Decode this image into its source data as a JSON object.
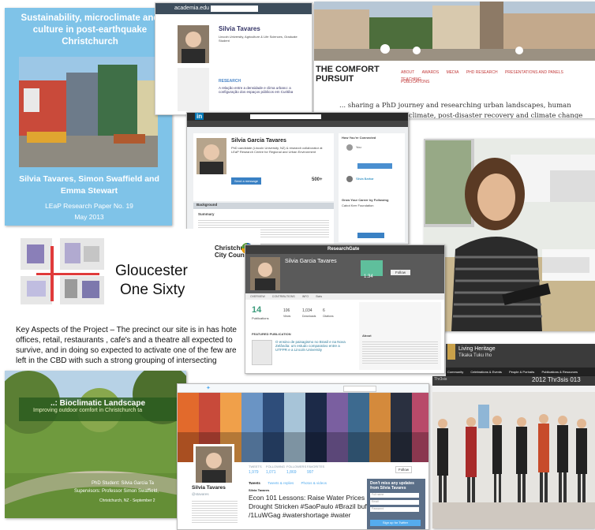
{
  "paper": {
    "title": "Sustainability, microclimate and culture in post-earthquake Christchurch",
    "authors": "Silvia Tavares, Simon Swaffield and Emma Stewart",
    "series": "LEaP Research Paper No. 19",
    "date": "May 2013"
  },
  "academia": {
    "logo": "academia.edu",
    "name": "Silvia Tavares",
    "subtitle": "Lincoln University, Agriculture & Life Sciences, Graduate Student",
    "section": "RESEARCH",
    "paper_title": "A relação entre a densidade e clima urbano: a configuração dos espaços públicos em Curitiba"
  },
  "blog": {
    "title_line1": "THE COMFORT",
    "title_line2": "PURSUIT",
    "nav": [
      "ABOUT",
      "AWARDS",
      "MEDIA",
      "PHD RESEARCH",
      "PRESENTATIONS AND PANELS",
      "PUBLICATIONS",
      "TEACHING"
    ],
    "tagline1": "... sharing a PhD journey and researching urban landscapes, human",
    "tagline2": "climate, post-disaster recovery and climate change"
  },
  "linkedin": {
    "logo": "in",
    "name": "Silvia Garcia Tavares",
    "headline": "PhD candidate (Lincoln University, NZ) & research collaborator at LEaP Research Centre for Regional and Urban Environment",
    "section": "Background",
    "summary_title": "Summary",
    "side_title": "How You're Connected",
    "side_you": "You",
    "side_person": "Silvia Barbar",
    "side_cta": "Grow Your Career by Following",
    "side_company": "Cabot Kerr Foundation",
    "connections": "500+",
    "send_button": "Send a message"
  },
  "gloucester": {
    "title_line1": "Gloucester",
    "title_line2": "One Sixty",
    "council": "Christchurch",
    "council2": "City Council",
    "body1": "Key Aspects of the Project – The precinct our site is in has hote",
    "body2": "offices, retail, restaurants , cafe's and a theatre all expected to",
    "body3": "survive, and in doing so  expected to activate one of the few are",
    "body4": "left in the CBD with such a strong grouping of intersecting"
  },
  "researchgate": {
    "logo": "ResearchGate",
    "name": "Silvia Garcia Tavares",
    "score": "1.34",
    "stat_main": "14",
    "stat_main_label": "Publications",
    "stats": [
      "106",
      "1,034",
      "6"
    ],
    "stat_labels": [
      "Views",
      "Downloads",
      "Citations"
    ],
    "tabs": [
      "OVERVIEW",
      "CONTRIBUTIONS",
      "INFO",
      "Stats"
    ],
    "section": "FEATURED PUBLICATION",
    "pub": "O ensino de paisagismo no Brasil e na Nova Zelândia: um estudo comparativo entre a UTFPR e a Lincoln University",
    "about": "About",
    "follow": "Follow"
  },
  "bioclimatic": {
    "title": "..: Bioclimatic Landscape",
    "subtitle": "Improving outdoor comfort in Christchurch ta",
    "phd": "PhD Student: Silvia Garcia Ta",
    "supervisors": "Supervisors: Professor Simon Swaffield,",
    "place": "Christchurch, NZ - September 2"
  },
  "twitter": {
    "name": "Silvia Tavares",
    "handle": "@stavares",
    "stats": [
      "1,979",
      "1,071",
      "1,869",
      "997"
    ],
    "stat_labels": [
      "TWEETS",
      "FOLLOWING",
      "FOLLOWERS",
      "FAVORITES"
    ],
    "tabs": [
      "Tweets",
      "Tweets & replies",
      "Photos & videos"
    ],
    "tweet_author": "Silvia Tavares",
    "tweet_line1": "Econ 101 Lessons: Raise Water Prices in",
    "tweet_line2": "Drought Stricken #SaoPaulo #Brazil buff.ly",
    "tweet_line3": "/1LuWGag #watershortage #water",
    "signup_title": "Don't miss any updates from Silvia Tavares",
    "signup_button": "Sign up for Twitter",
    "fields": [
      "Full name",
      "Email",
      "Password"
    ],
    "follow": "Follow"
  },
  "heritage": {
    "title": "Living Heritage",
    "subtitle": "Tikaka Tuku Iho",
    "nav": [
      "Community",
      "Celebrations & Events",
      "People & Portraits",
      "Publications & Resources"
    ]
  },
  "group": {
    "banner": "2012 Thr3sis 013",
    "event": "Thr3sis"
  }
}
